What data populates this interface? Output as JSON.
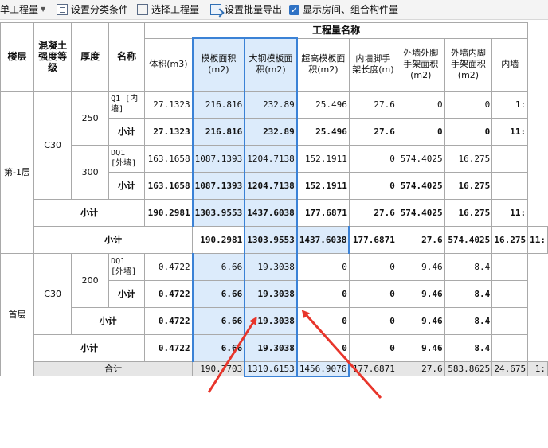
{
  "toolbar": {
    "items": [
      {
        "label": "单工程量",
        "icon": "dropdown"
      },
      {
        "label": "设置分类条件",
        "icon": "list-icon"
      },
      {
        "label": "选择工程量",
        "icon": "grid-icon"
      },
      {
        "label": "设置批量导出",
        "icon": "export-icon"
      },
      {
        "label": "显示房间、组合构件量",
        "icon": "checkbox-checked"
      }
    ]
  },
  "table": {
    "group_header": "工程量名称",
    "headers": {
      "floor": "楼层",
      "grade": "混凝土强度等级",
      "thickness": "厚度",
      "name": "名称",
      "c1": "体积(m3)",
      "c2": "模板面积(m2)",
      "c3": "大钢模板面积(m2)",
      "c4": "超高模板面积(m2)",
      "c5": "内墙脚手架长度(m)",
      "c6": "外墙外脚手架面积(m2)",
      "c7": "外墙内脚手架面积(m2)",
      "c8": "内墙"
    },
    "floor1": "第-1层",
    "floor2": "首层",
    "grade1": "C30",
    "grade2": "C30",
    "thick_250": "250",
    "thick_300": "300",
    "thick_200": "200",
    "rows": {
      "q1": {
        "name": "Q1 [内墙]",
        "c1": "27.1323",
        "c2": "216.816",
        "c3": "232.89",
        "c4": "25.496",
        "c5": "27.6",
        "c6": "0",
        "c7": "0",
        "c8": "1:"
      },
      "q1_sub": {
        "name": "小计",
        "c1": "27.1323",
        "c2": "216.816",
        "c3": "232.89",
        "c4": "25.496",
        "c5": "27.6",
        "c6": "0",
        "c7": "0",
        "c8": "11:"
      },
      "dq1": {
        "name": "DQ1 [外墙]",
        "c1": "163.1658",
        "c2": "1087.1393",
        "c3": "1204.7138",
        "c4": "152.1911",
        "c5": "0",
        "c6": "574.4025",
        "c7": "16.275",
        "c8": ""
      },
      "dq1_sub": {
        "name": "小计",
        "c1": "163.1658",
        "c2": "1087.1393",
        "c3": "1204.7138",
        "c4": "152.1911",
        "c5": "0",
        "c6": "574.4025",
        "c7": "16.275",
        "c8": ""
      },
      "grade_sub": {
        "name": "小计",
        "c1": "190.2981",
        "c2": "1303.9553",
        "c3": "1437.6038",
        "c4": "177.6871",
        "c5": "27.6",
        "c6": "574.4025",
        "c7": "16.275",
        "c8": "11:"
      },
      "floor_sub": {
        "name": "小计",
        "c1": "190.2981",
        "c2": "1303.9553",
        "c3": "1437.6038",
        "c4": "177.6871",
        "c5": "27.6",
        "c6": "574.4025",
        "c7": "16.275",
        "c8": "11:"
      },
      "dq1b": {
        "name": "DQ1 [外墙]",
        "c1": "0.4722",
        "c2": "6.66",
        "c3": "19.3038",
        "c4": "0",
        "c5": "0",
        "c6": "9.46",
        "c7": "8.4",
        "c8": ""
      },
      "dq1b_sub": {
        "name": "小计",
        "c1": "0.4722",
        "c2": "6.66",
        "c3": "19.3038",
        "c4": "0",
        "c5": "0",
        "c6": "9.46",
        "c7": "8.4",
        "c8": ""
      },
      "grade2_sub": {
        "name": "小计",
        "c1": "0.4722",
        "c2": "6.66",
        "c3": "19.3038",
        "c4": "0",
        "c5": "0",
        "c6": "9.46",
        "c7": "8.4",
        "c8": ""
      },
      "floor2_sub": {
        "name": "小计",
        "c1": "0.4722",
        "c2": "6.66",
        "c3": "19.3038",
        "c4": "0",
        "c5": "0",
        "c6": "9.46",
        "c7": "8.4",
        "c8": ""
      },
      "total": {
        "name": "合计",
        "c1": "190.7703",
        "c2": "1310.6153",
        "c3": "1456.9076",
        "c4": "177.6871",
        "c5": "27.6",
        "c6": "583.8625",
        "c7": "24.675",
        "c8": "1:"
      }
    }
  },
  "colors": {
    "highlight_fill": "#dcebfb",
    "highlight_border": "#3b82d6",
    "arrow": "#e8352b"
  }
}
